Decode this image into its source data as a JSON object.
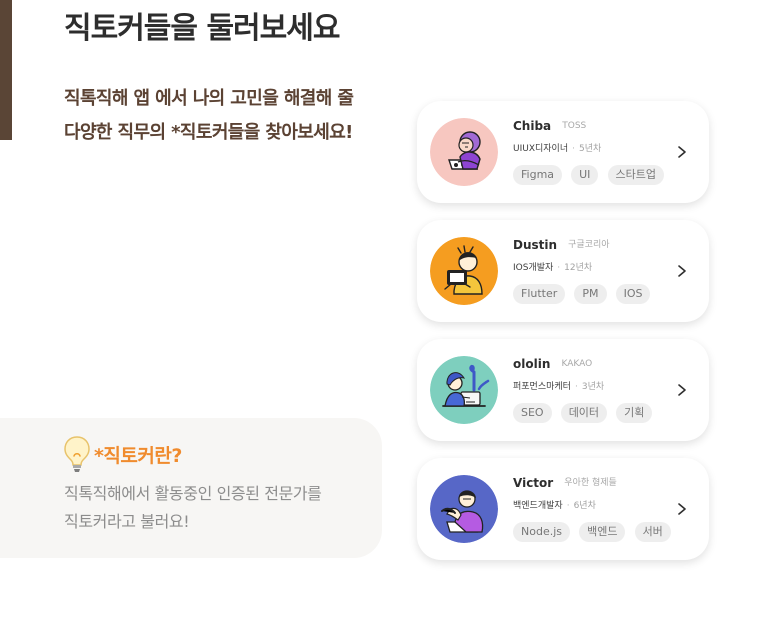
{
  "page": {
    "title": "직토커들을 둘러보세요",
    "intro": {
      "line1": "직톡직해  앱 에서 나의 고민을 해결해 줄",
      "line2": "다양한 직무의 *직토커들을 찾아보세요!"
    },
    "definition": {
      "title": "*직토커란?",
      "line1": "직톡직해에서 활동중인 인증된 전문가를",
      "line2": "직토커라고 불러요!"
    }
  },
  "colors": {
    "brand_brown": "#5a4536",
    "accent_orange": "#f08b2d",
    "avatar_backgrounds": [
      "#f7c7c0",
      "#f59d20",
      "#7ecfbe",
      "#5767c7"
    ]
  },
  "experts": [
    {
      "name": "Chiba",
      "company": "TOSS",
      "role": "UIUX디자이너",
      "separator": "·",
      "years": "5년차",
      "tags": [
        "Figma",
        "UI",
        "스타트업"
      ],
      "avatar_icon": "designer-laptop-icon",
      "chevron_icon": "chevron-right-icon"
    },
    {
      "name": "Dustin",
      "company": "구글코리아",
      "role": "IOS개발자",
      "separator": "·",
      "years": "12년차",
      "tags": [
        "Flutter",
        "PM",
        "IOS"
      ],
      "avatar_icon": "developer-tablet-icon",
      "chevron_icon": "chevron-right-icon"
    },
    {
      "name": "ololin",
      "company": "KAKAO",
      "role": "퍼포먼스마케터",
      "separator": "·",
      "years": "3년차",
      "tags": [
        "SEO",
        "데이터",
        "기획"
      ],
      "avatar_icon": "marketer-desk-icon",
      "chevron_icon": "chevron-right-icon"
    },
    {
      "name": "Victor",
      "company": "우아한 형제들",
      "role": "백엔드개발자",
      "separator": "·",
      "years": "6년차",
      "tags": [
        "Node.js",
        "백엔드",
        "서버"
      ],
      "avatar_icon": "backend-laptop-icon",
      "chevron_icon": "chevron-right-icon"
    }
  ]
}
